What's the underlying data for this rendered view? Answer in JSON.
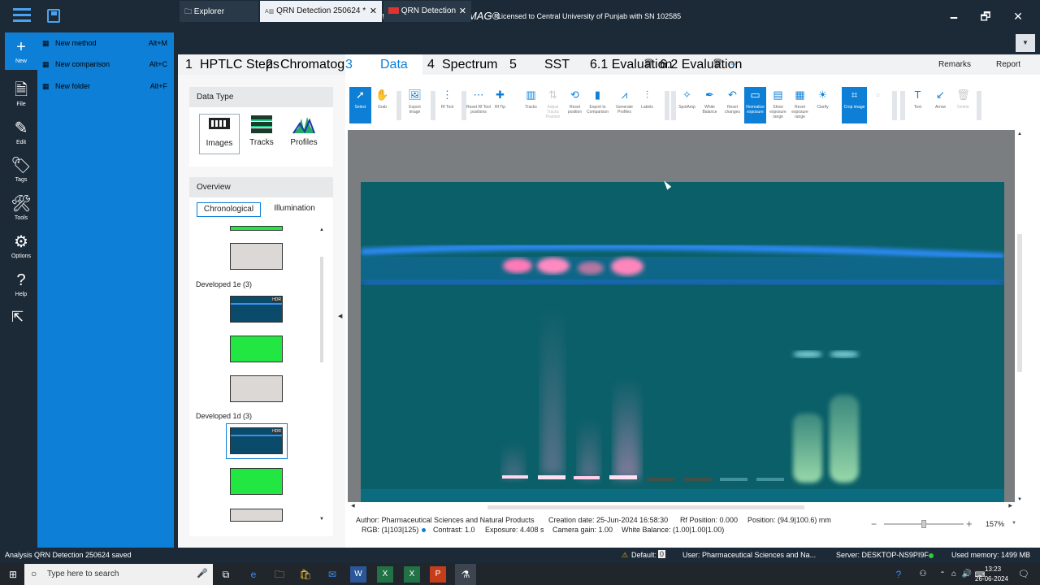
{
  "app": {
    "title": "visionCATS by CAMAG®",
    "dash": "–",
    "license": "Licensed to Central University of Punjab with SN 102585",
    "minimize": "🗕",
    "maximize": "🗗",
    "close": "✕"
  },
  "rail": [
    {
      "label": "New",
      "icon": "plus-icon",
      "glyph": "+"
    },
    {
      "label": "File",
      "icon": "file-icon",
      "glyph": "🗎"
    },
    {
      "label": "Edit",
      "icon": "pencil-icon",
      "glyph": "✎"
    },
    {
      "label": "Tags",
      "icon": "tag-icon",
      "glyph": "🏷"
    },
    {
      "label": "Tools",
      "icon": "tools-icon",
      "glyph": "🛠"
    },
    {
      "label": "Options",
      "icon": "gear-icon",
      "glyph": "⚙"
    },
    {
      "label": "Help",
      "icon": "help-icon",
      "glyph": "?"
    }
  ],
  "new_menu": [
    {
      "label": "New method",
      "shortcut": "Alt+M"
    },
    {
      "label": "New comparison",
      "shortcut": "Alt+C"
    },
    {
      "label": "New folder",
      "shortcut": "Alt+F"
    }
  ],
  "tabs": [
    {
      "label": "Explorer"
    },
    {
      "label": "QRN Detection 250624 *",
      "close": "✕"
    },
    {
      "label": "QRN Detection",
      "close": "✕"
    }
  ],
  "tab_dropdown": "▼",
  "steps": [
    {
      "num": "1",
      "label": "HPTLC Steps"
    },
    {
      "num": "2",
      "label": "Chromatography"
    },
    {
      "num": "3",
      "label": "Data"
    },
    {
      "num": "4",
      "label": "Spectrum"
    },
    {
      "num": "5",
      "label": "SST"
    },
    {
      "num": "",
      "label": "6.1  Evaluation"
    },
    {
      "num": "",
      "label": "6.2  Evaluation"
    }
  ],
  "step_add": "+",
  "step_actions": {
    "remarks": "Remarks",
    "report": "Report"
  },
  "data_type": {
    "header": "Data Type",
    "buttons": [
      "Images",
      "Tracks",
      "Profiles"
    ]
  },
  "overview": {
    "header": "Overview",
    "tabs": [
      "Chronological",
      "Illumination"
    ],
    "groups": [
      "Developed 1e (3)",
      "Developed 1d (3)"
    ],
    "hdr_badge": "HDR"
  },
  "toolbar": [
    {
      "label": "Select",
      "icon": "cursor-icon",
      "glyph": "➚",
      "state": "on"
    },
    {
      "label": "Grab",
      "icon": "hand-icon",
      "glyph": "✋",
      "state": "normal"
    },
    {
      "label": "Export image",
      "icon": "export-image-icon",
      "glyph": "🖼",
      "state": "normal"
    },
    {
      "label": "Rf Tool",
      "icon": "rf-tool-icon",
      "glyph": "⋮",
      "state": "normal"
    },
    {
      "label": "Reset Rf Tool positions",
      "icon": "reset-rf-icon",
      "glyph": "⋯",
      "state": "normal"
    },
    {
      "label": "Rf Tip",
      "icon": "rf-tip-icon",
      "glyph": "✚",
      "state": "normal"
    },
    {
      "label": "Tracks",
      "icon": "tracks-icon",
      "glyph": "▥",
      "state": "normal"
    },
    {
      "label": "Adjust Tracks Position",
      "icon": "adjust-tracks-icon",
      "glyph": "⇅",
      "state": "dis"
    },
    {
      "label": "Reset position",
      "icon": "reset-position-icon",
      "glyph": "⟲",
      "state": "normal"
    },
    {
      "label": "Export to Comparison",
      "icon": "export-comparison-icon",
      "glyph": "▮",
      "state": "normal"
    },
    {
      "label": "Generate Profiles",
      "icon": "profiles-icon",
      "glyph": "⩘",
      "state": "normal"
    },
    {
      "label": "Labels",
      "icon": "labels-icon",
      "glyph": "⫶",
      "state": "normal"
    },
    {
      "label": "SpotAmp",
      "icon": "spotamp-icon",
      "glyph": "✧",
      "state": "normal"
    },
    {
      "label": "White Balance",
      "icon": "dropper-icon",
      "glyph": "✒",
      "state": "normal"
    },
    {
      "label": "Reset changes",
      "icon": "undo-icon",
      "glyph": "↶",
      "state": "normal"
    },
    {
      "label": "Normalize exposure",
      "icon": "normalize-icon",
      "glyph": "▭",
      "state": "on"
    },
    {
      "label": "Show exposure range",
      "icon": "exposure-range-icon",
      "glyph": "▤",
      "state": "normal"
    },
    {
      "label": "Reset exposure range",
      "icon": "reset-exposure-icon",
      "glyph": "▦",
      "state": "normal"
    },
    {
      "label": "Clarify",
      "icon": "sun-icon",
      "glyph": "☀",
      "state": "normal"
    },
    {
      "label": "Crop image",
      "icon": "crop-icon",
      "glyph": "⌗",
      "state": "on"
    },
    {
      "label": "",
      "icon": "disabled-tool-icon",
      "glyph": "▫",
      "state": "dis"
    },
    {
      "label": "Text",
      "icon": "text-icon",
      "glyph": "T",
      "state": "normal"
    },
    {
      "label": "Arrow",
      "icon": "arrow-icon",
      "glyph": "↙",
      "state": "normal"
    },
    {
      "label": "Delete",
      "icon": "trash-icon",
      "glyph": "🗑",
      "state": "dis"
    }
  ],
  "info": {
    "author": "Author: Pharmaceutical Sciences and Natural Products",
    "created": "Creation date: 25-Jun-2024 16:58:30",
    "rf": "Rf Position: 0.000",
    "position": "Position: (94.9|100.6) mm",
    "rgb": "RGB: (1|103|125)",
    "contrast": "Contrast: 1.0",
    "exposure": "Exposure: 4.408 s",
    "gain": "Camera gain: 1.00",
    "wb": "White Balance: (1.00|1.00|1.00)"
  },
  "zoom": {
    "minus": "−",
    "plus": "+",
    "value": "157%",
    "caret": "▼"
  },
  "status": {
    "saved": "Analysis QRN Detection 250624 saved",
    "default_label": "Default:",
    "default_count": "0",
    "user": "User: Pharmaceutical Sciences and Na...",
    "server": "Server: DESKTOP-NS9PI9F",
    "memory": "Used memory: 1499 MB"
  },
  "taskbar": {
    "search_placeholder": "Type here to search",
    "time": "13:23",
    "date": "26-06-2024"
  },
  "colors": {
    "accent": "#0e7fd6",
    "rail": "#1c2a38",
    "plate": "#0a5f68"
  }
}
